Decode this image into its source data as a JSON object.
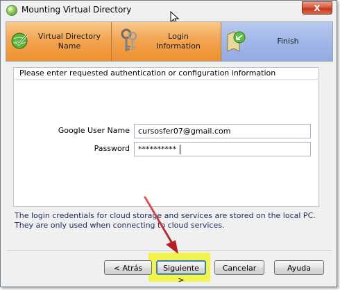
{
  "window": {
    "title": "Mounting Virtual Directory",
    "close_label": "X"
  },
  "steps": [
    {
      "line1": "Virtual Directory",
      "line2": "Name"
    },
    {
      "line1": "Login",
      "line2": "Information"
    },
    {
      "line1": "Finish"
    }
  ],
  "panel": {
    "title": "Please enter requested authentication or configuration information"
  },
  "form": {
    "user_label": "Google User Name",
    "user_value": "cursosfer07@gmail.com",
    "password_label": "Password",
    "password_value": "**********"
  },
  "info_text": "The login credentials for cloud storage and services are stored on the local PC. They are only used when connecting to cloud services.",
  "buttons": {
    "back": "< Atrás",
    "next": "Siguiente >",
    "cancel": "Cancelar",
    "help": "Ayuda"
  },
  "colors": {
    "step_orange": "#f3a552",
    "step_active": "#a2b7e8",
    "highlight": "#f3f34e",
    "arrow": "#c0292b",
    "info_text": "#1c2a5a"
  }
}
